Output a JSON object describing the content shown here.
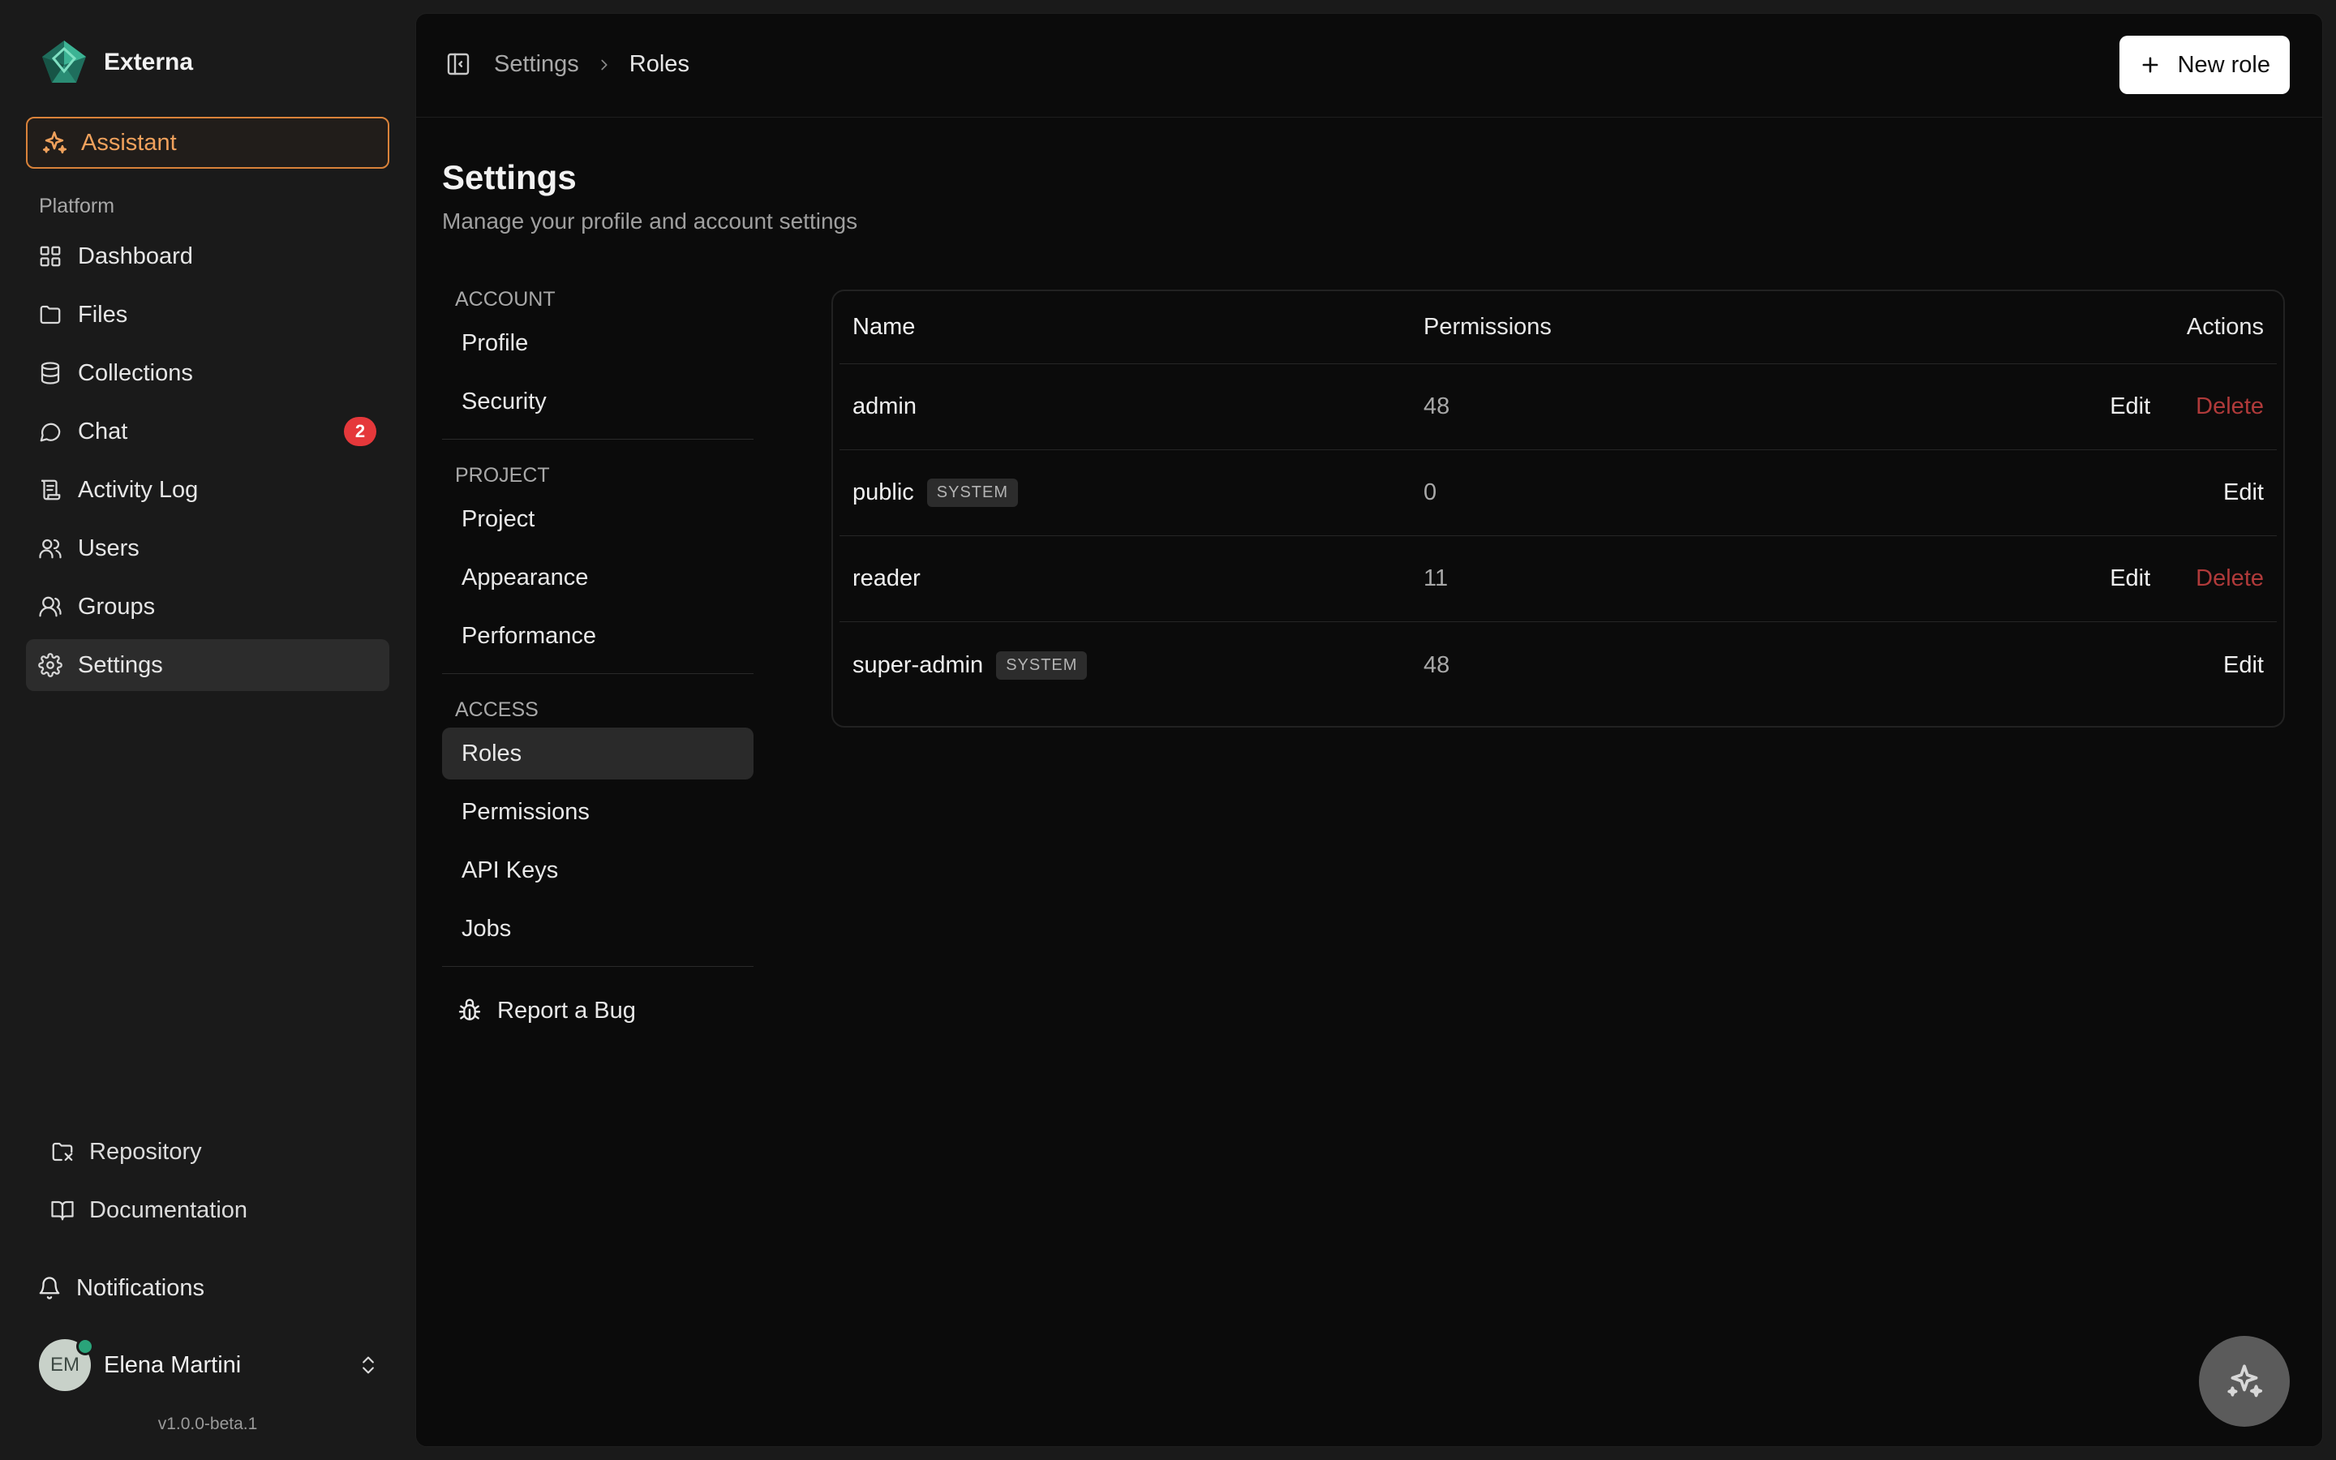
{
  "app": {
    "name": "Externa",
    "version": "v1.0.0-beta.1"
  },
  "sidebar": {
    "assistant_label": "Assistant",
    "section_label": "Platform",
    "items": [
      {
        "label": "Dashboard",
        "icon": "grid-icon"
      },
      {
        "label": "Files",
        "icon": "folder-icon"
      },
      {
        "label": "Collections",
        "icon": "database-icon"
      },
      {
        "label": "Chat",
        "icon": "chat-icon",
        "badge": "2"
      },
      {
        "label": "Activity Log",
        "icon": "scroll-icon"
      },
      {
        "label": "Users",
        "icon": "users-icon"
      },
      {
        "label": "Groups",
        "icon": "user-group-icon"
      },
      {
        "label": "Settings",
        "icon": "gear-icon",
        "active": true
      }
    ],
    "links": [
      {
        "label": "Repository",
        "icon": "repo-icon"
      },
      {
        "label": "Documentation",
        "icon": "book-icon"
      }
    ],
    "notifications_label": "Notifications",
    "user": {
      "initials": "EM",
      "name": "Elena Martini",
      "status_color": "#2aa47a"
    }
  },
  "header": {
    "breadcrumb": [
      "Settings",
      "Roles"
    ],
    "new_role_label": "New role"
  },
  "page": {
    "title": "Settings",
    "subtitle": "Manage your profile and account settings"
  },
  "subnav": {
    "sections": [
      {
        "label": "ACCOUNT",
        "items": [
          "Profile",
          "Security"
        ]
      },
      {
        "label": "PROJECT",
        "items": [
          "Project",
          "Appearance",
          "Performance"
        ]
      },
      {
        "label": "ACCESS",
        "items": [
          "Roles",
          "Permissions",
          "API Keys",
          "Jobs"
        ]
      }
    ],
    "active": "Roles",
    "report_bug_label": "Report a Bug"
  },
  "roles_table": {
    "columns": {
      "name": "Name",
      "permissions": "Permissions",
      "actions": "Actions"
    },
    "edit_label": "Edit",
    "delete_label": "Delete",
    "rows": [
      {
        "name": "admin",
        "permissions": "48",
        "system": false
      },
      {
        "name": "public",
        "permissions": "0",
        "system": true,
        "tag": "SYSTEM"
      },
      {
        "name": "reader",
        "permissions": "11",
        "system": false
      },
      {
        "name": "super-admin",
        "permissions": "48",
        "system": true,
        "tag": "SYSTEM"
      }
    ]
  },
  "colors": {
    "accent": "#f0a15c",
    "danger": "#b03a3a",
    "badge": "#e5383b"
  }
}
